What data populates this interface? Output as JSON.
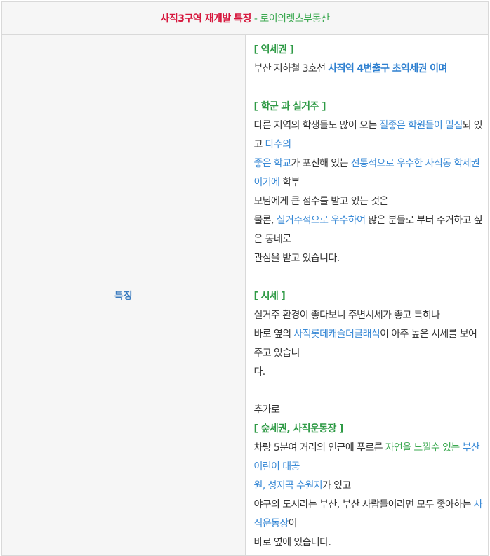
{
  "header": {
    "title": "사직3구역 재개발 특징",
    "sep": " - ",
    "brand": "로이의렛츠부동산"
  },
  "label": "특징",
  "sections": {
    "s1": {
      "heading": "[ 역세권 ]",
      "l1_a": "부산 지하철 3호선 ",
      "l1_b": "사직역 4번출구 초역세권 이며"
    },
    "s2": {
      "heading": "[ 학군 과 실거주 ]",
      "l1_a": "다른 지역의 학생들도 많이 오는 ",
      "l1_b": "질좋은 학원들이 밀집",
      "l1_c": "되 있고 ",
      "l1_d": "다수의",
      "l2_a": "좋은 학교",
      "l2_b": "가 포진해 있는 ",
      "l2_c": "전통적으로 우수한 사직동 학세권이기에",
      "l2_d": " 학부",
      "l3": "모님에게 큰 점수를 받고 있는 것은",
      "l4_a": "물론, ",
      "l4_b": "실거주적으로 우수하여",
      "l4_c": " 많은 분들로 부터 주거하고 싶은 동네로",
      "l5": "관심을 받고 있습니다."
    },
    "s3": {
      "heading": "[ 시세 ]",
      "l1": "실거주 환경이 좋다보니 주변시세가 좋고 특히나",
      "l2_a": "바로 옆의 ",
      "l2_b": "사직롯데캐슬더클래식",
      "l2_c": "이 아주 높은 시세를 보여주고 있습니",
      "l3": "다."
    },
    "s4": {
      "intro": "추가로",
      "heading": "[ 숲세권, 사직운동장 ]",
      "l1_a": "차량 5분여 거리의 인근에 푸르른 ",
      "l1_b": "자연을 느낄수 있는",
      "l1_c": " ",
      "l1_d": "부산어린이 대공",
      "l2_a": "원, 성지곡 수원지",
      "l2_b": "가 있고",
      "l3_a": "야구의 도시라는 부산, 부산 사람들이라면 모두 좋아하는 ",
      "l3_b": "사직운동장",
      "l3_c": "이",
      "l4": "바로 옆에 있습니다."
    }
  },
  "colors": {
    "title_red": "#d6163c",
    "brand_green": "#3aa84f",
    "heading_green": "#2e9a45",
    "highlight_blue": "#3a8ad6",
    "label_blue": "#3a7bbf"
  }
}
